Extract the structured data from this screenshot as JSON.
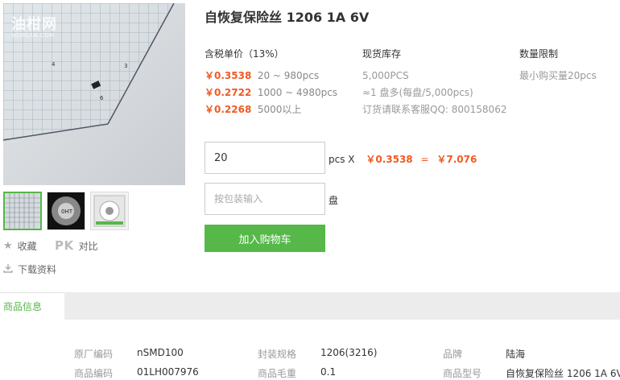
{
  "product": {
    "title": "自恢复保险丝 1206 1A 6V",
    "watermark": {
      "main": "油柑网",
      "sub": "YOUGAN.COM"
    }
  },
  "gallery": {
    "thumbnails": [
      {
        "name": "thumb-ruler-photo",
        "active": true
      },
      {
        "name": "thumb-reel-photo",
        "active": false
      },
      {
        "name": "thumb-package-photo",
        "active": false
      }
    ],
    "thumb2_text": "0HT"
  },
  "actions": {
    "favorite_label": "收藏",
    "compare_icon_text": "PK",
    "compare_label": "对比",
    "download_label": "下载资料"
  },
  "pricing": {
    "header": "含税单价（13%）",
    "tiers": [
      {
        "price": "￥0.3538",
        "range": "20 ~ 980pcs"
      },
      {
        "price": "￥0.2722",
        "range": "1000 ~ 4980pcs"
      },
      {
        "price": "￥0.2268",
        "range": "5000以上"
      }
    ]
  },
  "stock": {
    "header": "现货库存",
    "rows": [
      "5,000PCS",
      "≈1 盘多(每盘/5,000pcs)",
      "订货请联系客服QQ: 800158062"
    ]
  },
  "limit": {
    "header": "数量限制",
    "rows": [
      "最小购买量20pcs"
    ]
  },
  "order": {
    "qty_value": "20",
    "qty_unit": "pcs X",
    "unit_price": "￥0.3538",
    "equals": "=",
    "total": "￥7.076",
    "pack_placeholder": "按包装输入",
    "pack_unit": "盘",
    "cart_button": "加入购物车"
  },
  "tabs": {
    "active": "商品信息"
  },
  "info": {
    "row1": [
      {
        "label": "原厂编码",
        "value": "nSMD100"
      },
      {
        "label": "封装规格",
        "value": "1206(3216)"
      },
      {
        "label": "品牌",
        "value": "陆海"
      }
    ],
    "row2": [
      {
        "label": "商品编码",
        "value": "01LH007976"
      },
      {
        "label": "商品毛重",
        "value": "0.1"
      },
      {
        "label": "商品型号",
        "value": "自恢复保险丝 1206 1A 6V"
      }
    ]
  },
  "colors": {
    "accent_green": "#55b848",
    "price_orange": "#f05a24"
  }
}
